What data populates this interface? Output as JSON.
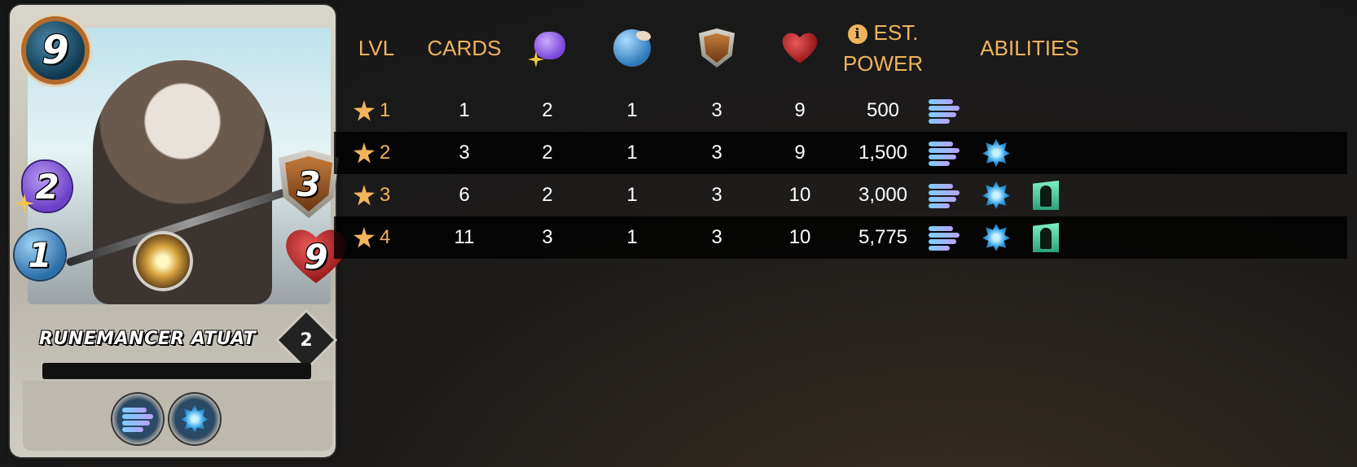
{
  "card": {
    "name": "RUNEMANCER ATUAT",
    "mana": "9",
    "magic": "2",
    "speed": "1",
    "armor": "3",
    "health": "9",
    "level": "2",
    "abilities": [
      "wind-ability-icon",
      "shard-ability-icon"
    ]
  },
  "table": {
    "headers": {
      "lvl": "LVL",
      "cards": "CARDS",
      "magic_icon": "magic-icon",
      "speed_icon": "speed-icon",
      "armor_icon": "armor-icon",
      "health_icon": "health-icon",
      "power_line1": "EST.",
      "power_line2": "POWER",
      "abilities": "ABILITIES"
    },
    "rows": [
      {
        "lvl": "1",
        "cards": "1",
        "magic": "2",
        "speed": "1",
        "armor": "3",
        "health": "9",
        "power": "500",
        "abilities": [
          "wind-ability-icon"
        ]
      },
      {
        "lvl": "2",
        "cards": "3",
        "magic": "2",
        "speed": "1",
        "armor": "3",
        "health": "9",
        "power": "1,500",
        "abilities": [
          "wind-ability-icon",
          "shard-ability-icon"
        ]
      },
      {
        "lvl": "3",
        "cards": "6",
        "magic": "2",
        "speed": "1",
        "armor": "3",
        "health": "10",
        "power": "3,000",
        "abilities": [
          "wind-ability-icon",
          "shard-ability-icon",
          "armor-man-ability-icon"
        ]
      },
      {
        "lvl": "4",
        "cards": "11",
        "magic": "3",
        "speed": "1",
        "armor": "3",
        "health": "10",
        "power": "5,775",
        "abilities": [
          "wind-ability-icon",
          "shard-ability-icon",
          "armor-man-ability-icon"
        ]
      }
    ]
  },
  "colors": {
    "header_gold": "#f0b45c",
    "row_dark": "#000000",
    "value_text": "#ffffff"
  }
}
